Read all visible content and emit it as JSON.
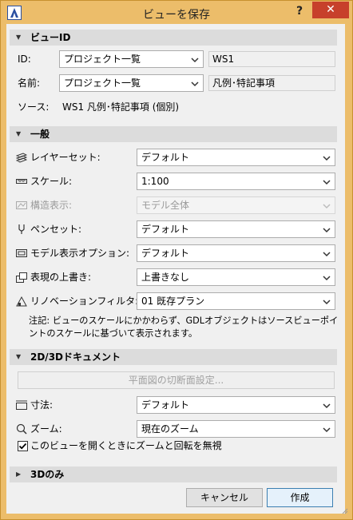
{
  "window": {
    "title": "ビューを保存",
    "help_label": "?",
    "close_label": "✕"
  },
  "view_id": {
    "header": "ビューID",
    "id_label": "ID:",
    "id_select": "プロジェクト一覧",
    "id_value": "WS1",
    "name_label": "名前:",
    "name_select": "プロジェクト一覧",
    "name_value": "凡例･特記事項",
    "source_label": "ソース:",
    "source_value": "WS1 凡例･特記事項 (個別)"
  },
  "general": {
    "header": "一般",
    "layer_set_label": "レイヤーセット:",
    "layer_set_value": "デフォルト",
    "scale_label": "スケール:",
    "scale_value": "1:100",
    "structure_label": "構造表示:",
    "structure_value": "モデル全体",
    "pen_set_label": "ペンセット:",
    "pen_set_value": "デフォルト",
    "model_view_label": "モデル表示オプション:",
    "model_view_value": "デフォルト",
    "override_label": "表現の上書き:",
    "override_value": "上書きなし",
    "renovation_label": "リノベーションフィルタ:",
    "renovation_value": "01 既存プラン",
    "note": "注記: ビューのスケールにかかわらず、GDLオブジェクトはソースビューポイントのスケールに基づいて表示されます。"
  },
  "doc2d3d": {
    "header": "2D/3Dドキュメント",
    "cut_plane_button": "平面図の切断面設定...",
    "dimension_label": "寸法:",
    "dimension_value": "デフォルト",
    "zoom_label": "ズーム:",
    "zoom_value": "現在のズーム",
    "ignore_zoom_label": "このビューを開くときにズームと回転を無視",
    "ignore_zoom_checked": true
  },
  "only3d": {
    "header": "3Dのみ"
  },
  "footer": {
    "cancel_label": "キャンセル",
    "create_label": "作成"
  }
}
